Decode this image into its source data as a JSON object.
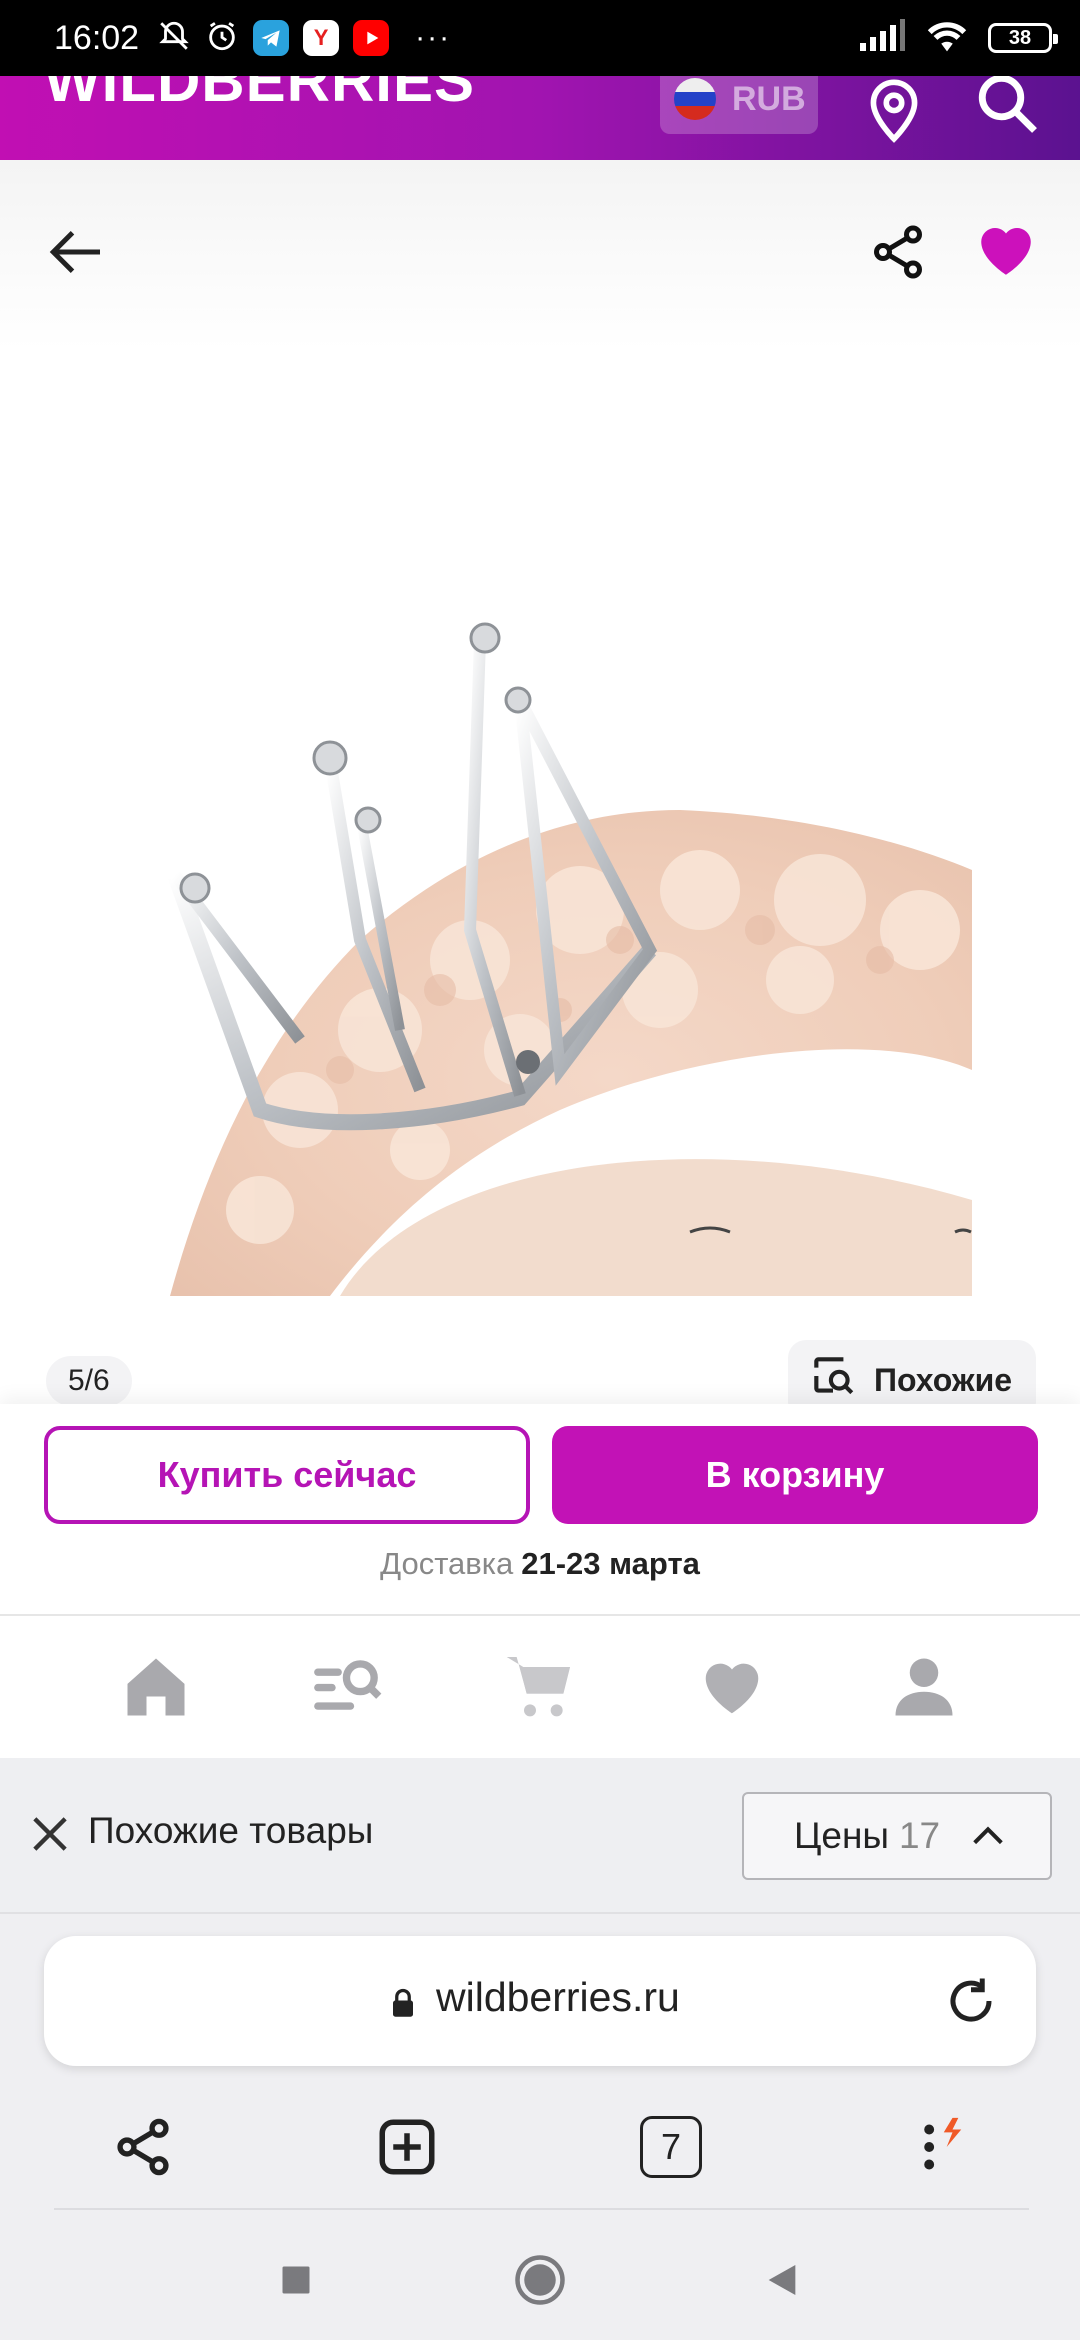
{
  "status_bar": {
    "time": "16:02",
    "battery": "38",
    "more_indicator": "···",
    "icons": [
      "mute-alarm-icon",
      "alarm-icon",
      "telegram-icon",
      "yandex-icon",
      "youtube-icon",
      "signal-icon",
      "wifi-icon"
    ]
  },
  "header": {
    "logo": "WILDBERRIES",
    "currency": "RUB",
    "brand_gradient": [
      "#c10fb3",
      "#5b1290"
    ]
  },
  "product": {
    "image_counter": "5/6",
    "similar_label": "Похожие",
    "favorite_color": "#cc11bb"
  },
  "actions": {
    "buy_now": "Купить сейчас",
    "add_to_cart": "В корзину",
    "accent_color": "#c212b6"
  },
  "delivery": {
    "label": "Доставка",
    "dates": "21-23 марта"
  },
  "bottom_nav": [
    "home-icon",
    "catalog-search-icon",
    "cart-icon",
    "favorites-icon",
    "profile-icon"
  ],
  "similar_bar": {
    "title": "Похожие товары",
    "prices_label": "Цены",
    "prices_count": "17"
  },
  "browser": {
    "url": "wildberries.ru",
    "tabs_count": "7"
  }
}
